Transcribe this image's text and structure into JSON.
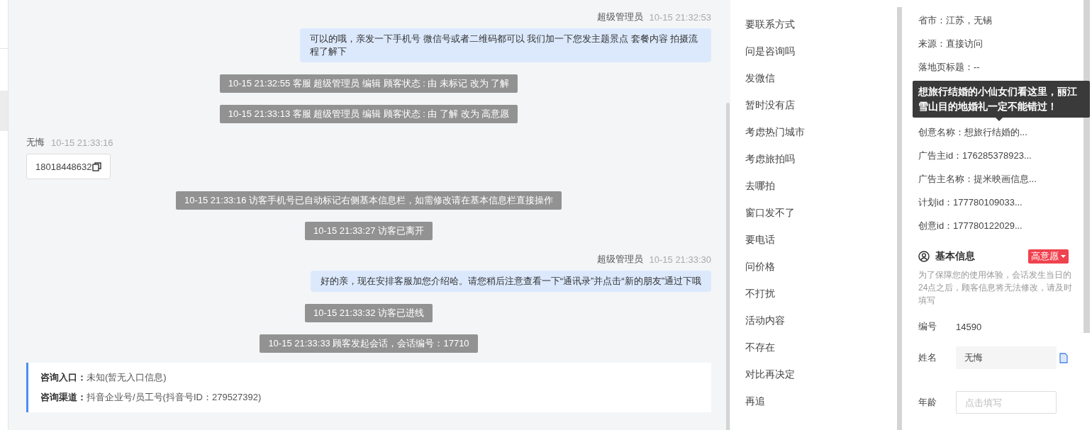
{
  "chat": {
    "messages": [
      {
        "kind": "agent",
        "sender": "超级管理员",
        "time": "10-15 21:32:53",
        "text": "可以的哦，亲发一下手机号 微信号或者二维码都可以 我们加一下您发主题景点 套餐内容 拍摄流程了解下"
      },
      {
        "kind": "system",
        "text": "10-15 21:32:55 客服 超级管理员 编辑 顾客状态 : 由 未标记 改为 了解"
      },
      {
        "kind": "system",
        "text": "10-15 21:33:13 客服 超级管理员 编辑 顾客状态 : 由 了解 改为 高意愿"
      },
      {
        "kind": "visitor",
        "sender": "无悔",
        "time": "10-15 21:33:16",
        "text": "18018448632"
      },
      {
        "kind": "system",
        "text": "10-15 21:33:16 访客手机号已自动标记右侧基本信息栏，如需修改请在基本信息栏直接操作"
      },
      {
        "kind": "system",
        "text": "10-15 21:33:27 访客已离开"
      },
      {
        "kind": "agent",
        "sender": "超级管理员",
        "time": "10-15 21:33:30",
        "text": "好的亲，现在安排客服加您介绍哈。请您稍后注意查看一下“通讯录”并点击“新的朋友”通过下哦"
      },
      {
        "kind": "system",
        "text": "10-15 21:33:32 访客已进线"
      },
      {
        "kind": "system",
        "text": "10-15 21:33:33 顾客发起会话，会话编号：17710"
      }
    ],
    "entry_card": {
      "rows": [
        {
          "label": "咨询入口：",
          "value": "未知(暂无入口信息)"
        },
        {
          "label": "咨询渠道：",
          "value": "抖音企业号/员工号(抖音号ID：279527392)"
        }
      ]
    }
  },
  "quick_replies": [
    "要联系方式",
    "问是咨询吗",
    "发微信",
    "暂时没有店",
    "考虑热门城市",
    "考虑旅拍吗",
    "去哪拍",
    "窗口发不了",
    "要电话",
    "问价格",
    "不打扰",
    "活动内容",
    "不存在",
    "对比再决定",
    "再追"
  ],
  "visitor_info": {
    "rows_top": [
      "省市：江苏，无锡",
      "来源：直接访问",
      "落地页标题：--"
    ],
    "tooltip": "想旅行结婚的小仙女们看这里，丽江雪山目的地婚礼一定不能错过！",
    "rows_bottom": [
      "创意名称：想旅行结婚的...",
      "广告主id：176285378923...",
      "广告主名称：提米映画信息...",
      "计划id：177780109033...",
      "创意id：177780122029..."
    ]
  },
  "basic_info": {
    "title": "基本信息",
    "status": "高意愿",
    "note": "为了保障您的使用体验，会话发生当日的24点之后，顾客信息将无法修改，请及时填写",
    "fields": [
      {
        "kind": "text",
        "label": "编号",
        "value": "14590"
      },
      {
        "kind": "copyable",
        "label": "姓名",
        "value": "无悔"
      },
      {
        "kind": "input",
        "label": "年龄",
        "placeholder": "点击填写"
      }
    ]
  }
}
